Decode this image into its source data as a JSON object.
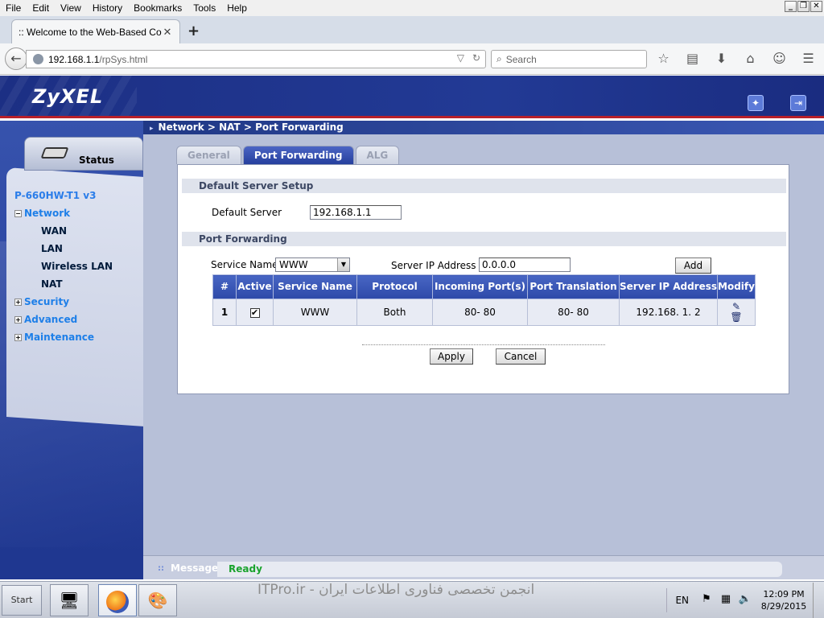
{
  "browser": {
    "menu": [
      "File",
      "Edit",
      "View",
      "History",
      "Bookmarks",
      "Tools",
      "Help"
    ],
    "tab_title": ":: Welcome to the Web-Based Co...",
    "url_host": "192.168.1.1",
    "url_path": "/rpSys.html",
    "search_placeholder": "Search"
  },
  "router": {
    "brand": "ZyXEL",
    "breadcrumb": "Network > NAT > Port Forwarding",
    "status_label": "Status",
    "nav": {
      "model": "P-660HW-T1 v3",
      "network": "Network",
      "wan": "WAN",
      "lan": "LAN",
      "wireless_lan": "Wireless LAN",
      "nat": "NAT",
      "security": "Security",
      "advanced": "Advanced",
      "maintenance": "Maintenance"
    },
    "tabs": {
      "general": "General",
      "port_forwarding": "Port Forwarding",
      "alg": "ALG"
    },
    "default_server_section": "Default Server Setup",
    "default_server_label": "Default Server",
    "default_server_value": "192.168.1.1",
    "port_forwarding_section": "Port Forwarding",
    "service_name_label": "Service Name",
    "service_name_value": "WWW",
    "server_ip_label": "Server IP Address",
    "server_ip_value": "0.0.0.0",
    "add_label": "Add",
    "table": {
      "headers": {
        "num": "#",
        "active": "Active",
        "service": "Service Name",
        "protocol": "Protocol",
        "incoming": "Incoming Port(s)",
        "translation": "Port Translation",
        "server_ip": "Server IP Address",
        "modify": "Modify"
      },
      "rows": [
        {
          "num": "1",
          "active": "✔",
          "service": "WWW",
          "protocol": "Both",
          "incoming": "80- 80",
          "translation": "80- 80",
          "server_ip": "192.168. 1. 2"
        }
      ]
    },
    "apply_label": "Apply",
    "cancel_label": "Cancel",
    "message_label": "Message",
    "message_value": "Ready"
  },
  "taskbar": {
    "start_text": "Start",
    "watermark": "انجمن تخصصی فناوری اطلاعات ایران - ITPro.ir",
    "lang": "EN",
    "time": "12:09 PM",
    "date": "8/29/2015"
  },
  "colors": {
    "zyxel_blue": "#223a95",
    "header_red": "#b8202a",
    "ready_green": "#1aa32d",
    "nav_link": "#1e7fe8"
  }
}
